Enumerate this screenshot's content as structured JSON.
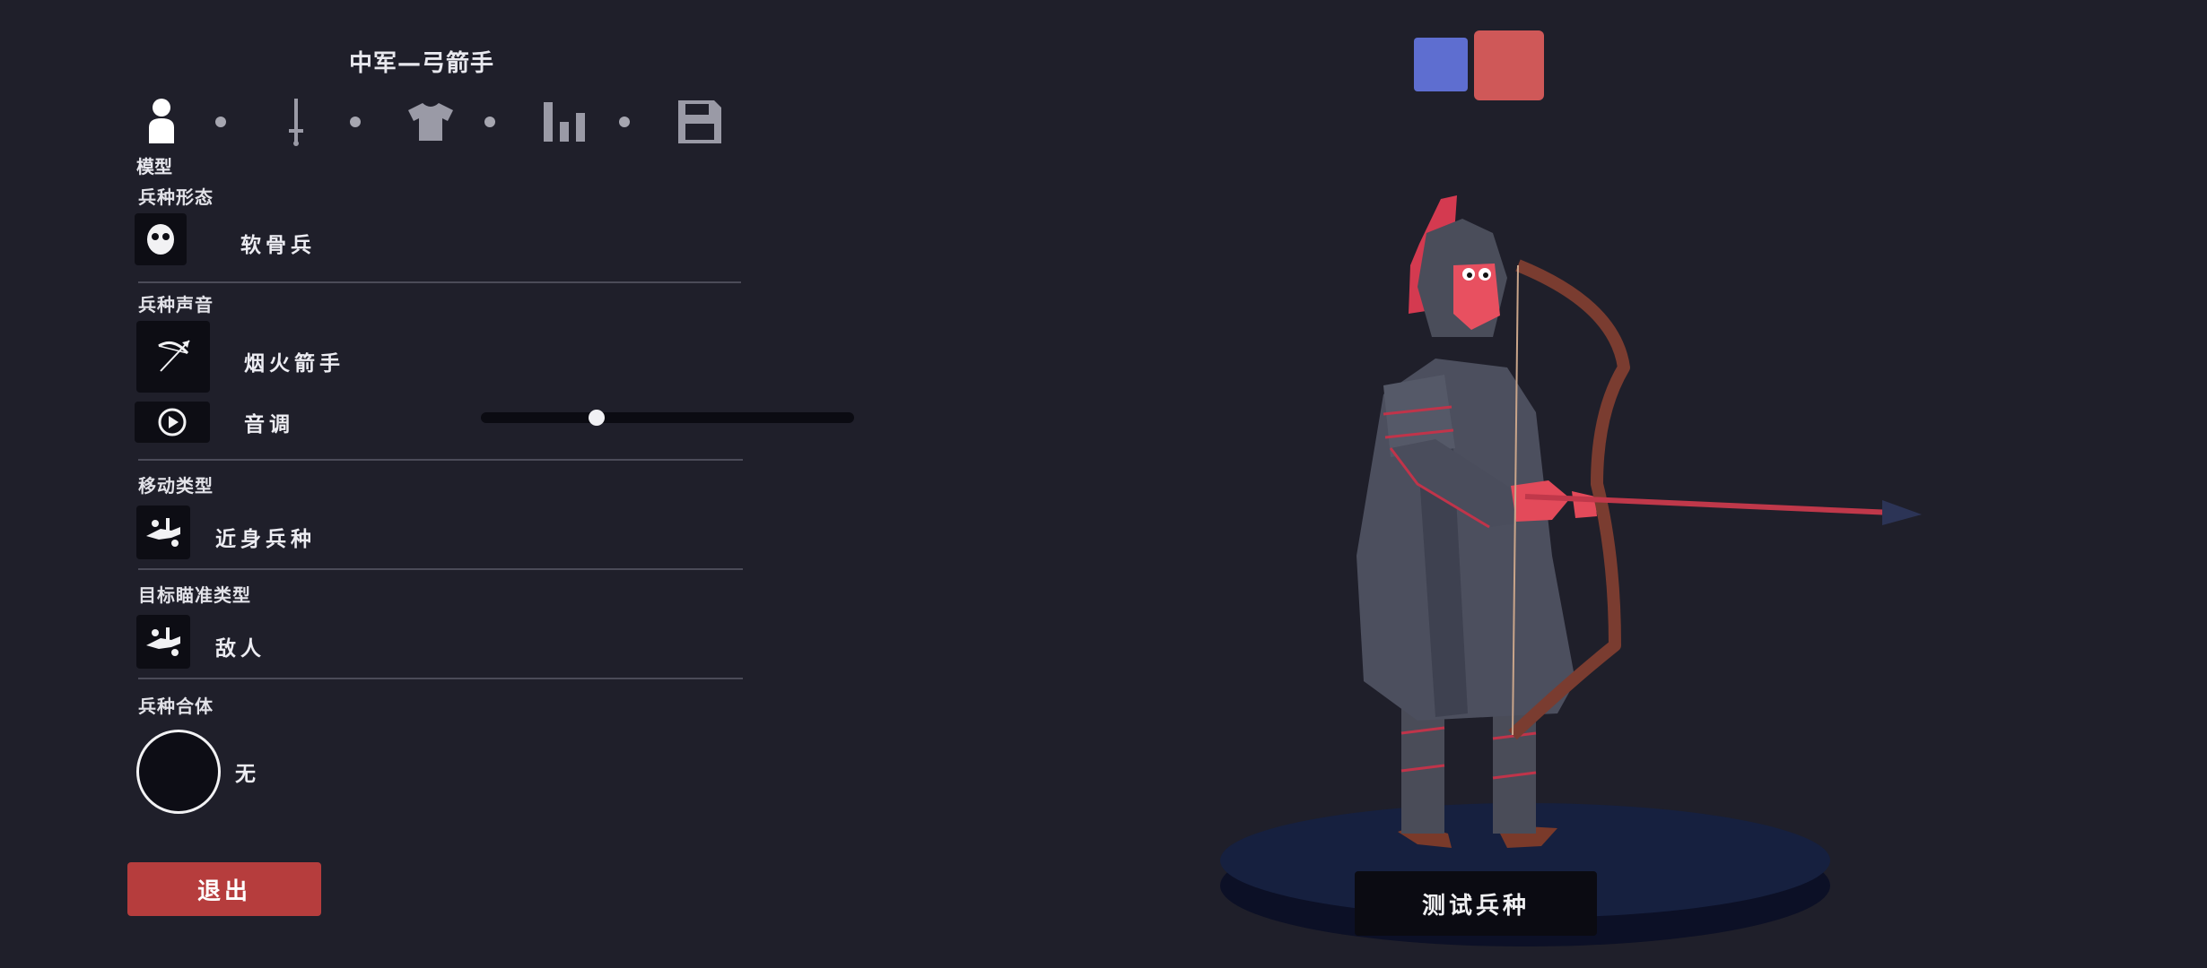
{
  "title": "中军—弓箭手",
  "tabs": [
    {
      "icon": "person-icon",
      "active": true
    },
    {
      "icon": "sword-icon",
      "active": false
    },
    {
      "icon": "shirt-icon",
      "active": false
    },
    {
      "icon": "bar-chart-icon",
      "active": false
    },
    {
      "icon": "save-icon",
      "active": false
    }
  ],
  "active_tab_label": "模型",
  "sections": {
    "unit_form": {
      "label": "兵种形态",
      "value": "软骨兵",
      "icon": "mask-icon"
    },
    "unit_voice": {
      "label": "兵种声音",
      "value": "烟火箭手",
      "icon": "bow-icon"
    },
    "pitch": {
      "label": "音调",
      "icon": "play-icon",
      "level": 0.31
    },
    "movement": {
      "label": "移动类型",
      "value": "近身兵种",
      "icon": "fallen-unit-icon"
    },
    "targeting": {
      "label": "目标瞄准类型",
      "value": "敌人",
      "icon": "fallen-unit-icon"
    },
    "combo": {
      "label": "兵种合体",
      "value": "无"
    }
  },
  "exit_button": "退出",
  "test_button": "测试兵种",
  "colors": {
    "background": "#1f1f2a",
    "team_blue": "#5e6ed0",
    "team_red": "#cf5858",
    "exit_button": "#b63d3d"
  }
}
